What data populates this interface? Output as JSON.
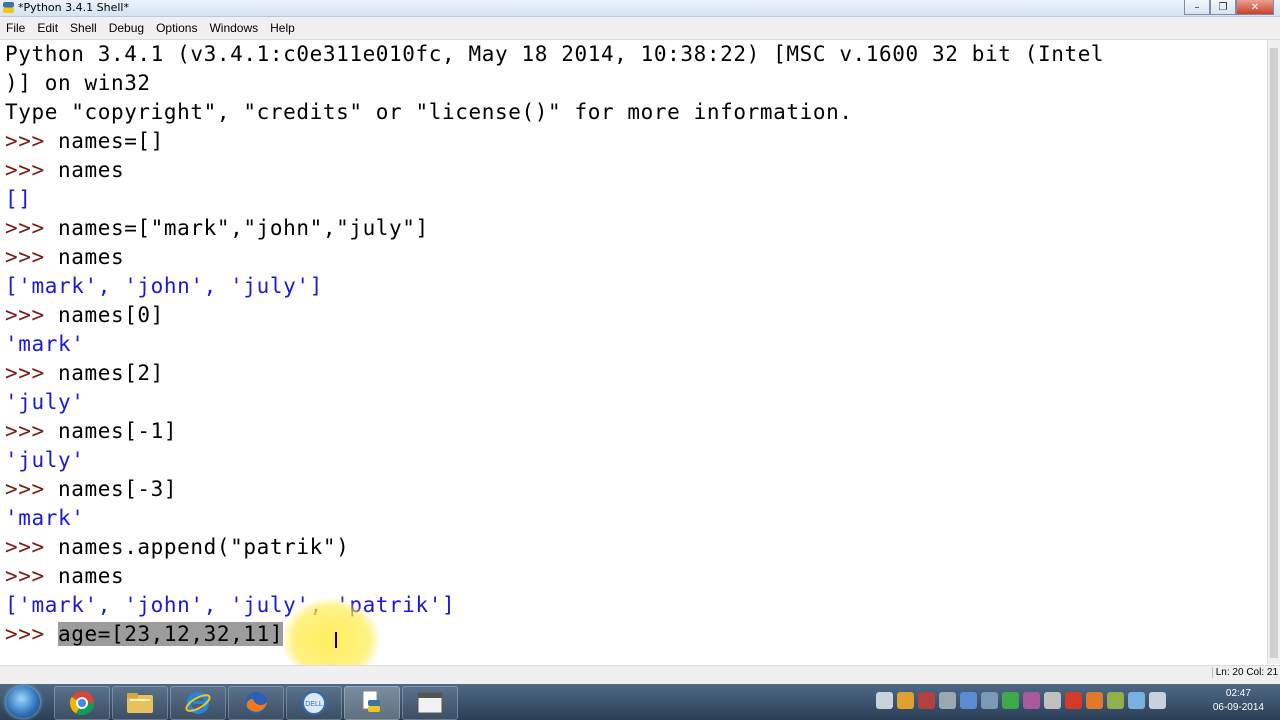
{
  "window": {
    "title": "*Python 3.4.1 Shell*",
    "controls": {
      "minimize": "–",
      "maximize": "❐",
      "close": "✕"
    }
  },
  "menu": {
    "items": [
      "File",
      "Edit",
      "Shell",
      "Debug",
      "Options",
      "Windows",
      "Help"
    ]
  },
  "shell": {
    "prompt": ">>>",
    "banner_1": "Python 3.4.1 (v3.4.1:c0e311e010fc, May 18 2014, 10:38:22) [MSC v.1600 32 bit (Intel",
    "banner_2": ")] on win32",
    "banner_3": "Type \"copyright\", \"credits\" or \"license()\" for more information.",
    "cmd_1": " names=[]",
    "cmd_2": " names",
    "out_2": "[]",
    "cmd_3": " names=[\"mark\",\"john\",\"july\"]",
    "cmd_4": " names",
    "out_4": "['mark', 'john', 'july']",
    "cmd_5": " names[0]",
    "out_5": "'mark'",
    "cmd_6": " names[2]",
    "out_6": "'july'",
    "cmd_7": " names[-1]",
    "out_7": "'july'",
    "cmd_8": " names[-3]",
    "out_8": "'mark'",
    "cmd_9": " names.append(\"patrik\")",
    "cmd_10": " names",
    "out_10": "['mark', 'john', 'july', 'patrik']",
    "current_input": "age=[23,12,32,11]"
  },
  "statusbar": {
    "text": "Ln: 20 Col: 21"
  },
  "taskbar": {
    "apps": [
      "chrome-icon",
      "file-explorer-icon",
      "internet-explorer-icon",
      "firefox-icon",
      "dell-icon",
      "python-idle-icon",
      "window-icon"
    ],
    "clock_time": "02:47",
    "clock_date": "06-09-2014"
  },
  "colors": {
    "output": "#1a1ad6",
    "prompt": "#7a1a12",
    "selection": "#9c9c9c"
  }
}
